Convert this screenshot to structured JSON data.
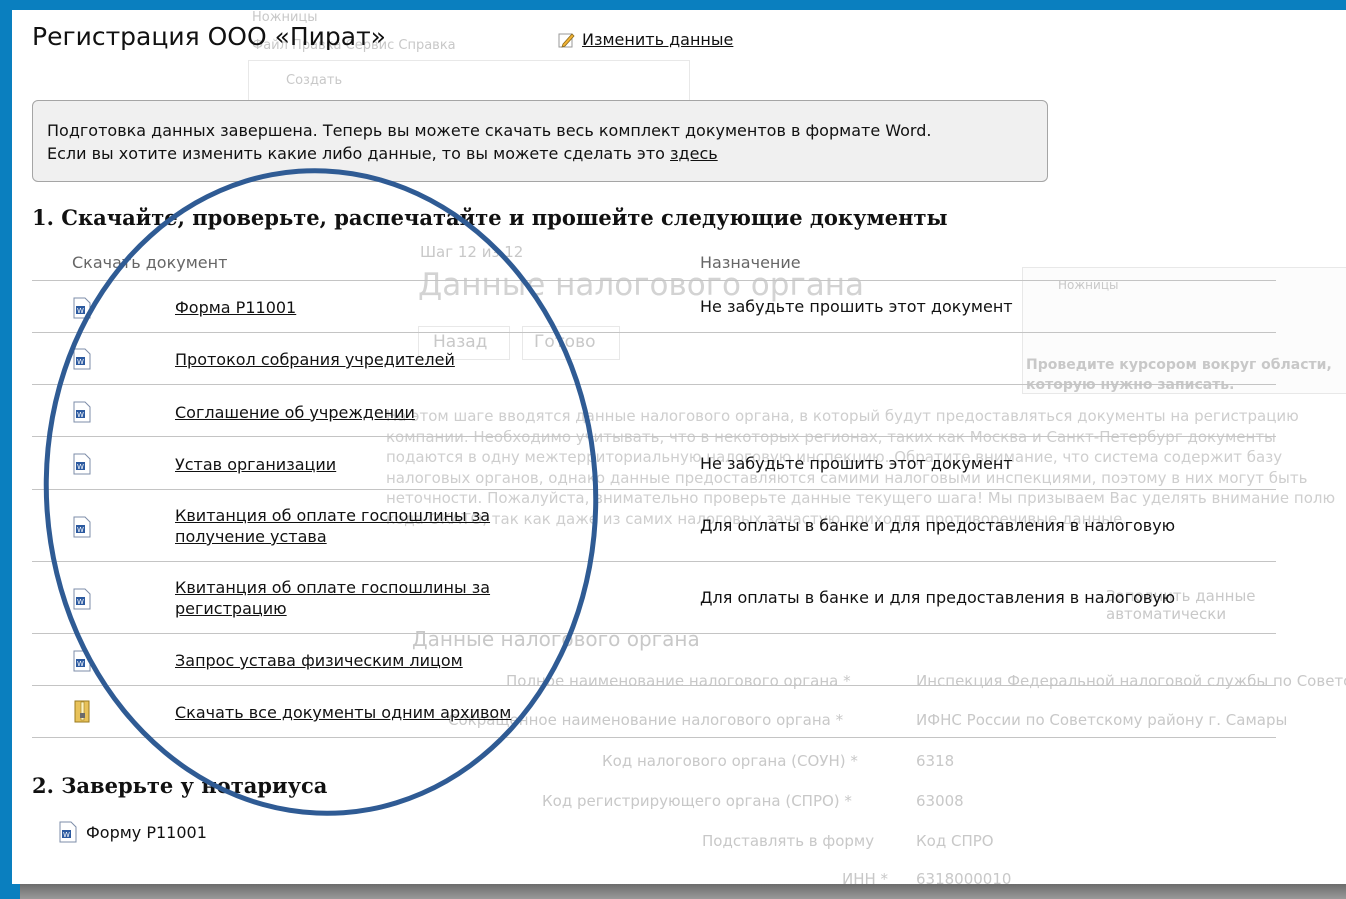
{
  "title": "Регистрация ООО «Пират»",
  "edit_link": "Изменить данные",
  "notice": {
    "line1": "Подготовка данных завершена. Теперь вы можете скачать весь комплект документов в формате Word.",
    "line2_prefix": "Если вы хотите изменить какие либо данные, то вы можете сделать это ",
    "line2_link": "здесь"
  },
  "section1_title": "1. Скачайте, проверьте, распечатайте и прошейте следующие документы",
  "columns": {
    "document": "Скачать документ",
    "purpose": "Назначение"
  },
  "rows": [
    {
      "doc": "Форма Р11001",
      "purpose": "Не забудьте прошить этот документ",
      "icon": "word-doc-icon"
    },
    {
      "doc": "Протокол собрания учредителей",
      "purpose": "",
      "icon": "word-doc-icon"
    },
    {
      "doc": "Соглашение об учреждении",
      "purpose": "",
      "icon": "word-doc-icon"
    },
    {
      "doc": "Устав организации",
      "purpose": "Не забудьте прошить этот документ",
      "icon": "word-doc-icon"
    },
    {
      "doc": "Квитанция об оплате госпошлины за получение устава",
      "purpose": "Для оплаты в банке и для предоставления в налоговую",
      "icon": "word-doc-icon"
    },
    {
      "doc": "Квитанция об оплате госпошлины за регистрацию",
      "purpose": "Для оплаты в банке и для предоставления в налоговую",
      "icon": "word-doc-icon"
    },
    {
      "doc": "Запрос устава физическим лицом",
      "purpose": "",
      "icon": "word-doc-icon"
    },
    {
      "doc": "Скачать все документы одним архивом",
      "purpose": "",
      "icon": "archive-icon"
    }
  ],
  "section2_title": "2. Заверьте у нотариуса",
  "notary_item": "Форму Р11001",
  "ghost": {
    "scissors": "Ножницы",
    "menu": "Файл   Правка   Сервис   Справка",
    "create": "Создать",
    "step": "Шаг 12 из 12",
    "heading": "Данные налогового органа",
    "back": "Назад",
    "done": "Готово",
    "snip_hint": "Проведите курсором вокруг области, которую нужно записать.",
    "para": "На этом шаге вводятся данные налогового органа, в который будут предоставляться документы на регистрацию компании. Необходимо учитывать, что в некоторых регионах, таких как Москва и Санкт-Петербург документы подаются в одну межтерриториальную налоговую инспекцию. Обратите внимание, что система содержит базу налоговых органов, однако данные предоставляются самими налоговыми инспекциями, поэтому в них могут быть неточности. Пожалуйста, внимательно проверьте данные текущего шага! Мы призываем Вас уделять внимание полю кода ОКАТО, так как даже из самих налоговых зачастую приходят противоречивые данные.",
    "fill_auto": "Заполнить данные автоматически",
    "sub": "Данные налогового органа",
    "f1_label": "Полное наименование налогового органа *",
    "f1_value": "Инспекция Федеральной налоговой службы по Советскому району г. Самары",
    "f2_label": "Сокращенное наименование налогового органа *",
    "f2_value": "ИФНС России по Советскому району г. Самары",
    "f3_label": "Код налогового органа (СОУН) *",
    "f3_value": "6318",
    "f4_label": "Код регистрирующего органа (СПРО) *",
    "f4_value": "63008",
    "f5_label": "Подставлять в форму",
    "f5_value": "Код СПРО",
    "f6_label": "ИНН *",
    "f6_value": "6318000010"
  }
}
